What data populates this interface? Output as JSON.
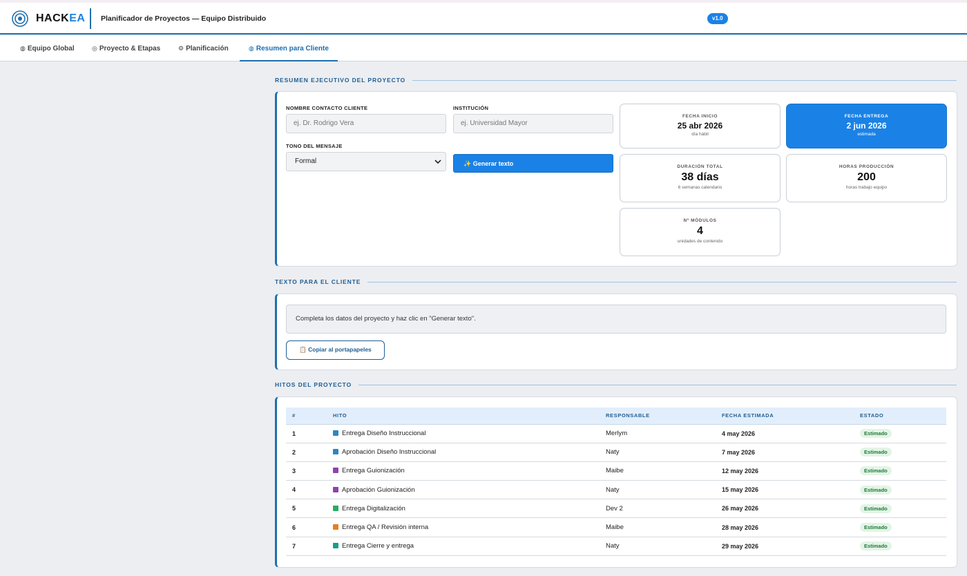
{
  "app": {
    "logo_main": "HACK",
    "logo_accent": "EA",
    "title": "Planificador de Proyectos — Equipo Distribuido",
    "version": "v1.0"
  },
  "tabs": [
    {
      "label": "Equipo Global",
      "icon": "globe-icon",
      "active": false
    },
    {
      "label": "Proyecto & Etapas",
      "icon": "target-icon",
      "active": false
    },
    {
      "label": "Planificación",
      "icon": "gear-icon",
      "active": false
    },
    {
      "label": "Resumen para Cliente",
      "icon": "globe-icon",
      "active": true
    }
  ],
  "summary": {
    "section_title": "RESUMEN EJECUTIVO DEL PROYECTO",
    "contact_label": "NOMBRE CONTACTO CLIENTE",
    "contact_placeholder": "ej. Dr. Rodrigo Vera",
    "institution_label": "INSTITUCIÓN",
    "institution_placeholder": "ej. Universidad Mayor",
    "tone_label": "TONO DEL MENSAJE",
    "tone_value": "Formal",
    "generate_label": "✨ Generar texto",
    "stats": [
      {
        "label": "FECHA INICIO",
        "value": "25 abr 2026",
        "sub": "día hábil"
      },
      {
        "label": "FECHA ENTREGA",
        "value": "2 jun 2026",
        "sub": "estimada"
      },
      {
        "label": "DURACIÓN TOTAL",
        "value": "38 días",
        "sub": "6 semanas calendario"
      },
      {
        "label": "HORAS PRODUCCIÓN",
        "value": "200",
        "sub": "horas trabajo equipo"
      },
      {
        "label": "Nº MÓDULOS",
        "value": "4",
        "sub": "unidades de contenido"
      }
    ]
  },
  "client_text": {
    "section_title": "TEXTO PARA EL CLIENTE",
    "body": "Completa los datos del proyecto y haz clic en \"Generar texto\".",
    "copy_label": "📋 Copiar al portapapeles"
  },
  "milestones": {
    "section_title": "HITOS DEL PROYECTO",
    "headers": [
      "#",
      "HITO",
      "RESPONSABLE",
      "FECHA ESTIMADA",
      "ESTADO"
    ],
    "rows": [
      {
        "n": "1",
        "name": "Entrega Diseño Instruccional",
        "color": "#2e86c1",
        "owner": "Merlym",
        "date": "4 may 2026",
        "status": "Estimado"
      },
      {
        "n": "2",
        "name": "Aprobación Diseño Instruccional",
        "color": "#2e86c1",
        "owner": "Naty",
        "date": "7 may 2026",
        "status": "Estimado"
      },
      {
        "n": "3",
        "name": "Entrega Guionización",
        "color": "#8e44ad",
        "owner": "Maibe",
        "date": "12 may 2026",
        "status": "Estimado"
      },
      {
        "n": "4",
        "name": "Aprobación Guionización",
        "color": "#8e44ad",
        "owner": "Naty",
        "date": "15 may 2026",
        "status": "Estimado"
      },
      {
        "n": "5",
        "name": "Entrega Digitalización",
        "color": "#27ae60",
        "owner": "Dev 2",
        "date": "26 may 2026",
        "status": "Estimado"
      },
      {
        "n": "6",
        "name": "Entrega QA / Revisión interna",
        "color": "#e67e22",
        "owner": "Maibe",
        "date": "28 may 2026",
        "status": "Estimado"
      },
      {
        "n": "7",
        "name": "Entrega Cierre y entrega",
        "color": "#16a085",
        "owner": "Naty",
        "date": "29 may 2026",
        "status": "Estimado"
      }
    ]
  }
}
